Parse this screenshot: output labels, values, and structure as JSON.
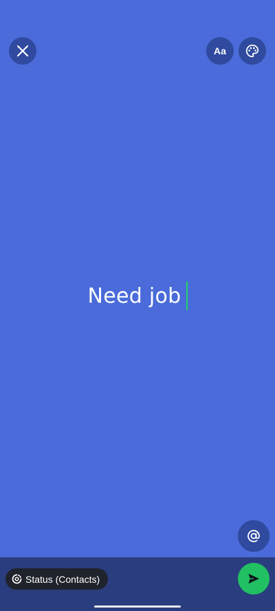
{
  "status": {
    "text": "Need job",
    "background_color": "#4a6bd9",
    "caret_color": "#25d366"
  },
  "toolbar": {
    "close_icon": "close-icon",
    "font_button_label": "Aa",
    "palette_icon": "palette-icon"
  },
  "mention": {
    "icon": "at-sign-icon"
  },
  "bottom_bar": {
    "audience_label": "Status (Contacts)",
    "audience_icon": "status-privacy-icon",
    "send_icon": "send-icon",
    "send_color": "#21c063"
  }
}
